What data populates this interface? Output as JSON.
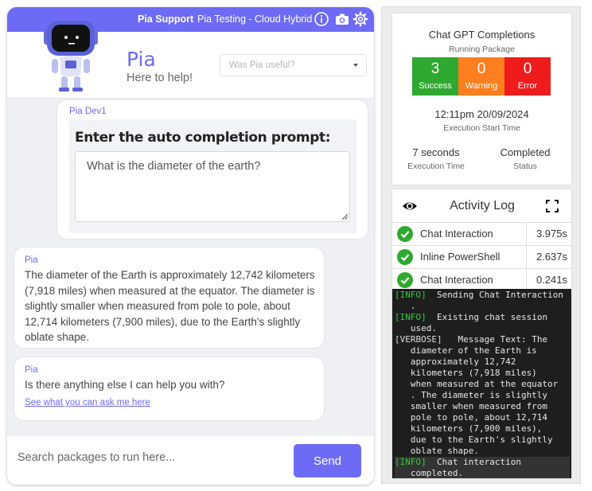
{
  "top_bar": {
    "support_label": "Pia Support",
    "workspace": "Pia Testing - Cloud Hybrid",
    "accent_color": "#6d6bf5"
  },
  "header": {
    "bot_name": "Pia",
    "tagline": "Here to help!",
    "feedback_placeholder": "Was Pia useful?"
  },
  "messages": {
    "prompt": {
      "sender": "Pia Dev1",
      "title": "Enter the auto completion prompt:",
      "value": "What is the diameter of the earth?"
    },
    "answer": {
      "sender": "Pia",
      "text": "The diameter of the Earth is approximately 12,742 kilometers (7,918 miles) when measured at the equator. The diameter is slightly smaller when measured from pole to pole, about 12,714 kilometers (7,900 miles), due to the Earth's slightly oblate shape."
    },
    "followup": {
      "sender": "Pia",
      "text": "Is there anything else I can help you with?",
      "link": "See what you can ask me here"
    }
  },
  "input": {
    "placeholder": "Search packages to run here...",
    "send_label": "Send"
  },
  "summary": {
    "title": "Chat GPT Completions",
    "subtitle": "Running Package",
    "stats": [
      {
        "value": "3",
        "label": "Success",
        "color": "#2fa82f"
      },
      {
        "value": "0",
        "label": "Warning",
        "color": "#ff7f1f"
      },
      {
        "value": "0",
        "label": "Error",
        "color": "#ee1c1c"
      }
    ],
    "start_time": "12:11pm 20/09/2024",
    "start_time_label": "Execution Start Time",
    "exec_time": "7 seconds",
    "exec_time_label": "Execution Time",
    "status": "Completed",
    "status_label": "Status"
  },
  "activity_log": {
    "title": "Activity Log",
    "steps": [
      {
        "name": "Chat Interaction",
        "time": "3.975s"
      },
      {
        "name": "Inline PowerShell",
        "time": "2.637s"
      },
      {
        "name": "Chat Interaction",
        "time": "0.241s"
      }
    ],
    "console": [
      {
        "level": "[INFO]",
        "lines": [
          "  Sending Chat Interaction",
          "   ."
        ]
      },
      {
        "level": "[INFO]",
        "lines": [
          "  Existing chat session",
          "   used."
        ]
      },
      {
        "level": "[VERBOSE]",
        "lines": [
          "   Message Text: The",
          "   diameter of the Earth is",
          "   approximately 12,742",
          "   kilometers (7,918 miles)",
          "   when measured at the equator",
          "   . The diameter is slightly",
          "   smaller when measured from",
          "   pole to pole, about 12,714",
          "   kilometers (7,900 miles),",
          "   due to the Earth's slightly",
          "   oblate shape."
        ]
      },
      {
        "level": "[INFO]",
        "lines": [
          "  Chat interaction",
          "   completed."
        ]
      }
    ]
  }
}
